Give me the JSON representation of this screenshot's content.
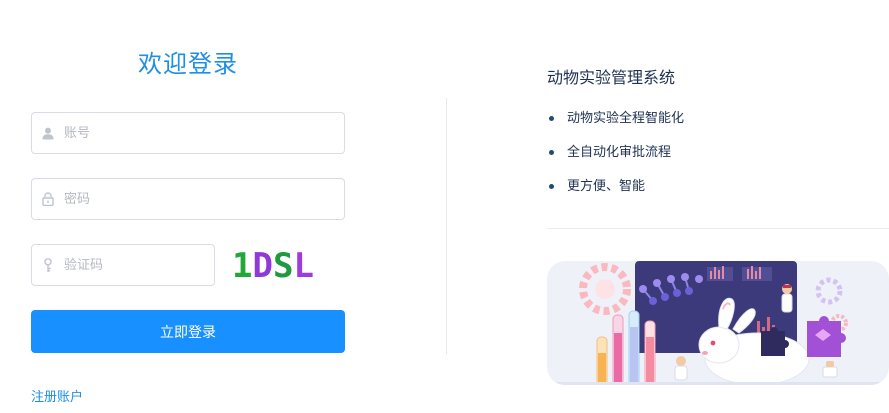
{
  "login": {
    "title": "欢迎登录",
    "account_placeholder": "账号",
    "password_placeholder": "密码",
    "captcha_placeholder": "验证码",
    "captcha_chars": [
      {
        "ch": "1",
        "color": "#22a83a"
      },
      {
        "ch": "D",
        "color": "#8f3ad6"
      },
      {
        "ch": "S",
        "color": "#1f9a3e"
      },
      {
        "ch": "L",
        "color": "#9b3be0"
      }
    ],
    "submit_label": "立即登录",
    "register_label": "注册账户"
  },
  "info": {
    "title": "动物实验管理系统",
    "features": [
      "动物实验全程智能化",
      "全自动化审批流程",
      "更方便、智能"
    ]
  },
  "colors": {
    "accent": "#1990ff",
    "title_blue": "#1e8fe6",
    "text_dark": "#1f3150"
  },
  "icons": {
    "account": "user-icon",
    "password": "lock-icon",
    "captcha": "key-icon"
  }
}
